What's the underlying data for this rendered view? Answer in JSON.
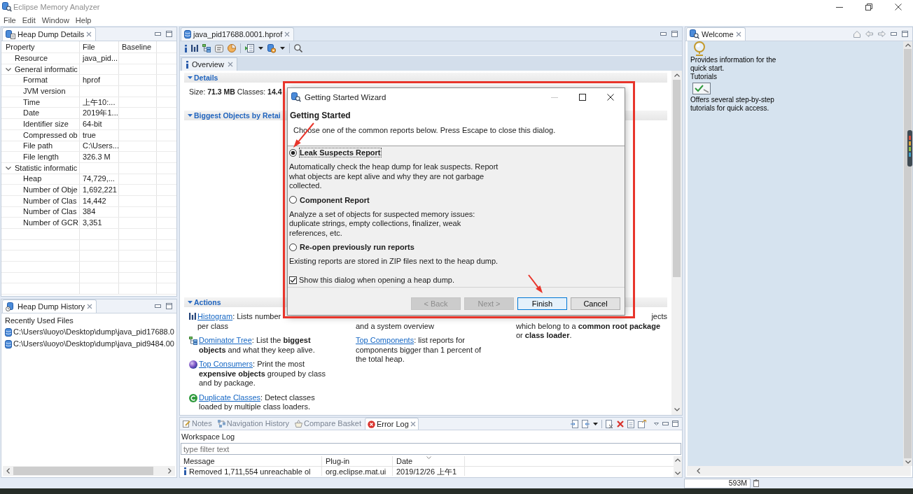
{
  "window": {
    "title": "Eclipse Memory Analyzer"
  },
  "menu": [
    "File",
    "Edit",
    "Window",
    "Help"
  ],
  "heap_dump_details": {
    "title": "Heap Dump Details",
    "columns": [
      "Property",
      "File",
      "Baseline"
    ],
    "rows": [
      {
        "property": "Resource",
        "file": "java_pid..."
      },
      {
        "property": "General informatic",
        "expanded": true,
        "children": [
          {
            "property": "Format",
            "file": "hprof"
          },
          {
            "property": "JVM version"
          },
          {
            "property": "Time",
            "file": "上午10:..."
          },
          {
            "property": "Date",
            "file": "2019年1..."
          },
          {
            "property": "Identifier size",
            "file": "64-bit"
          },
          {
            "property": "Compressed ob",
            "file": "true"
          },
          {
            "property": "File path",
            "file": "C:\\Users..."
          },
          {
            "property": "File length",
            "file": "326.3 M"
          }
        ]
      },
      {
        "property": "Statistic informatic",
        "expanded": true,
        "children": [
          {
            "property": "Heap",
            "file": "74,729,..."
          },
          {
            "property": "Number of Obje",
            "file": "1,692,221"
          },
          {
            "property": "Number of Clas",
            "file": "14,442"
          },
          {
            "property": "Number of Clas",
            "file": "384"
          },
          {
            "property": "Number of GCR",
            "file": "3,351"
          }
        ]
      }
    ]
  },
  "heap_dump_history": {
    "title": "Heap Dump History",
    "heading": "Recently Used Files",
    "files": [
      "C:\\Users\\luoyo\\Desktop\\dump\\java_pid17688.0",
      "C:\\Users\\luoyo\\Desktop\\dump\\java_pid9484.00"
    ]
  },
  "editor": {
    "tab": "java_pid17688.0001.hprof",
    "subtab": "Overview",
    "details": {
      "title": "Details",
      "expanded": true,
      "summary": "Size: **71.3 MB** Classes: **14.4**"
    },
    "biggest_objects": {
      "title": "Biggest Objects by Retai",
      "expanded": true
    },
    "actions": {
      "title": "Actions",
      "expanded": true,
      "columns": [
        [
          {
            "link": "Histogram",
            "text": ": Lists number\nper class"
          },
          {
            "link": "Dominator Tree",
            "text": ": List the **biggest**\n**objects** and what they keep alive."
          },
          {
            "link": "Top Consumers",
            "text": ": Print the most\n**expensive objects** grouped by class\nand by package."
          },
          {
            "link": "Duplicate Classes",
            "text": ": Detect classes\nloaded by multiple class loaders."
          }
        ],
        [
          {
            "text": "and a system overview"
          },
          {
            "link": "Top Components",
            "text": ": list reports for\ncomponents bigger than 1 percent of\nthe total heap."
          }
        ],
        [
          {
            "fragment": "jects",
            "text": "which belong to a **common root package**\nor **class loader**."
          }
        ]
      ]
    }
  },
  "error_log": {
    "tabs": [
      {
        "label": "Notes",
        "selected": false
      },
      {
        "label": "Navigation History",
        "selected": false
      },
      {
        "label": "Compare Basket",
        "selected": false
      },
      {
        "label": "Error Log",
        "selected": true
      }
    ],
    "heading": "Workspace Log",
    "filter": {
      "placeholder": "type filter text"
    },
    "columns": [
      "Message",
      "Plug-in",
      "Date"
    ],
    "rows": [
      {
        "message": "Removed 1,711,554 unreachable ol",
        "plugin": "org.eclipse.mat.ui",
        "date": "2019/12/26 上午1"
      }
    ]
  },
  "welcome": {
    "title": "Welcome",
    "items": [
      {
        "description": "Provides information for the quick start."
      },
      {
        "title": "Tutorials",
        "description": "Offers several step-by-step tutorials for quick access."
      }
    ]
  },
  "status_bar": {
    "heap_status": "593M"
  },
  "dialog": {
    "title": "Getting Started Wizard",
    "heading": "Getting Started",
    "description": "Choose one of the common reports below. Press Escape to close this dialog.",
    "options": [
      {
        "label": "Leak Suspects Report",
        "selected": true,
        "description": "Automatically check the heap dump for leak suspects. Report\nwhat objects are kept alive and why they are not garbage\ncollected."
      },
      {
        "label": "Component Report",
        "selected": false,
        "description": "Analyze a set of objects for suspected memory issues:\nduplicate strings, empty collections, finalizer, weak\nreferences, etc."
      },
      {
        "label": "Re-open previously run reports",
        "selected": false,
        "description": "Existing reports are stored in ZIP files next to the heap dump."
      }
    ],
    "checkbox": {
      "label": "Show this dialog when opening a heap dump.",
      "checked": true
    },
    "buttons": [
      {
        "label": "< Back",
        "disabled": true,
        "focused": false
      },
      {
        "label": "Next >",
        "disabled": true,
        "focused": false
      },
      {
        "label": "Finish",
        "disabled": false,
        "focused": true
      },
      {
        "label": "Cancel",
        "disabled": false,
        "focused": false
      }
    ]
  }
}
